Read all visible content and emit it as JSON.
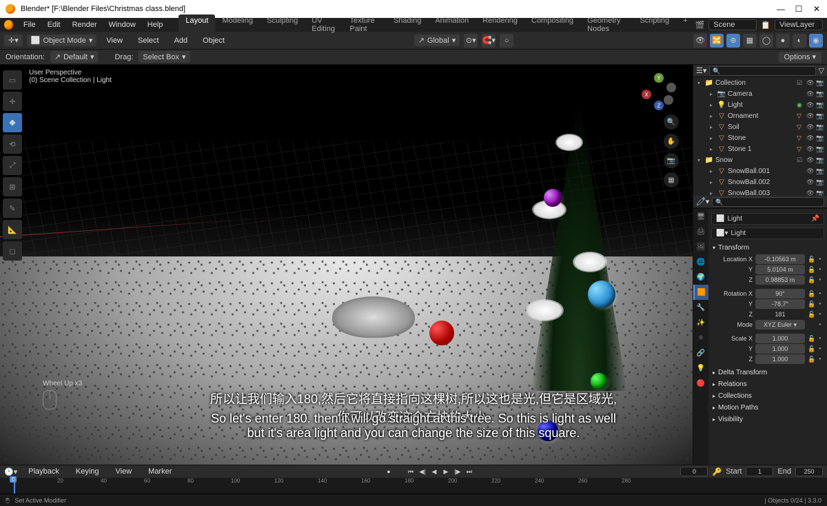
{
  "window": {
    "title": "Blender* [F:\\Blender Files\\Christmas class.blend]"
  },
  "menu": {
    "file": "File",
    "edit": "Edit",
    "render": "Render",
    "window": "Window",
    "help": "Help"
  },
  "workspaces": {
    "layout": "Layout",
    "modeling": "Modeling",
    "sculpting": "Sculpting",
    "uv": "UV Editing",
    "texpaint": "Texture Paint",
    "shading": "Shading",
    "animation": "Animation",
    "rendering": "Rendering",
    "compositing": "Compositing",
    "geonodes": "Geometry Nodes",
    "scripting": "Scripting",
    "add": "+"
  },
  "scene": {
    "label": "Scene",
    "viewlayer": "ViewLayer"
  },
  "toolbar": {
    "mode": "Object Mode",
    "view": "View",
    "select": "Select",
    "add": "Add",
    "object": "Object",
    "global": "Global"
  },
  "orient": {
    "label": "Orientation:",
    "value": "Default",
    "drag": "Drag:",
    "dragval": "Select Box",
    "options": "Options"
  },
  "viewport": {
    "title": "User Perspective",
    "subtitle": "(0) Scene Collection | Light",
    "wheel": "Wheel Up x3"
  },
  "outliner": {
    "collection": "Collection",
    "items": [
      {
        "name": "Camera",
        "icon": "📷"
      },
      {
        "name": "Light",
        "icon": "💡",
        "type": "light"
      },
      {
        "name": "Ornament",
        "icon": "▽"
      },
      {
        "name": "Soil",
        "icon": "▽"
      },
      {
        "name": "Stone",
        "icon": "▽"
      },
      {
        "name": "Stone 1",
        "icon": "▽"
      }
    ],
    "snow": "Snow",
    "snowballs": [
      {
        "name": "SnowBall.001"
      },
      {
        "name": "SnowBall.002"
      },
      {
        "name": "SnowBall.003"
      }
    ]
  },
  "props": {
    "selected": "Light",
    "object_name": "Light",
    "transform": "Transform",
    "loc": {
      "label": "Location X",
      "x": "-0.10563 m",
      "y": "5.0104 m",
      "z": "0.98853 m"
    },
    "rot": {
      "label": "Rotation X",
      "x": "90°",
      "y": "-78.7°",
      "z": "181"
    },
    "mode": {
      "label": "Mode",
      "value": "XYZ Euler"
    },
    "scale": {
      "label": "Scale X",
      "x": "1.000",
      "y": "1.000",
      "z": "1.000"
    },
    "sections": {
      "delta": "Delta Transform",
      "relations": "Relations",
      "collections": "Collections",
      "motion": "Motion Paths",
      "visibility": "Visibility"
    }
  },
  "timeline": {
    "playback": "Playback",
    "keying": "Keying",
    "view": "View",
    "marker": "Marker",
    "current": "0",
    "start": "Start",
    "startval": "1",
    "end": "End",
    "endval": "250",
    "ticks": [
      "0",
      "20",
      "40",
      "60",
      "80",
      "100",
      "120",
      "140",
      "160",
      "180",
      "200",
      "220",
      "240",
      "260",
      "280"
    ]
  },
  "status": {
    "left": "Set Active Modifier",
    "right": "| Objects 0/24 | 3.3.0"
  },
  "subtitles": {
    "cn": "所以让我们输入180,然后它将直接指向这棵树,所以这也是光,但它是区域光,你可以改变这个方块的大小,",
    "en": "So let's enter 180. then it will go straight at this tree. So this is light as well but it's area light and you can change the size of this square."
  }
}
